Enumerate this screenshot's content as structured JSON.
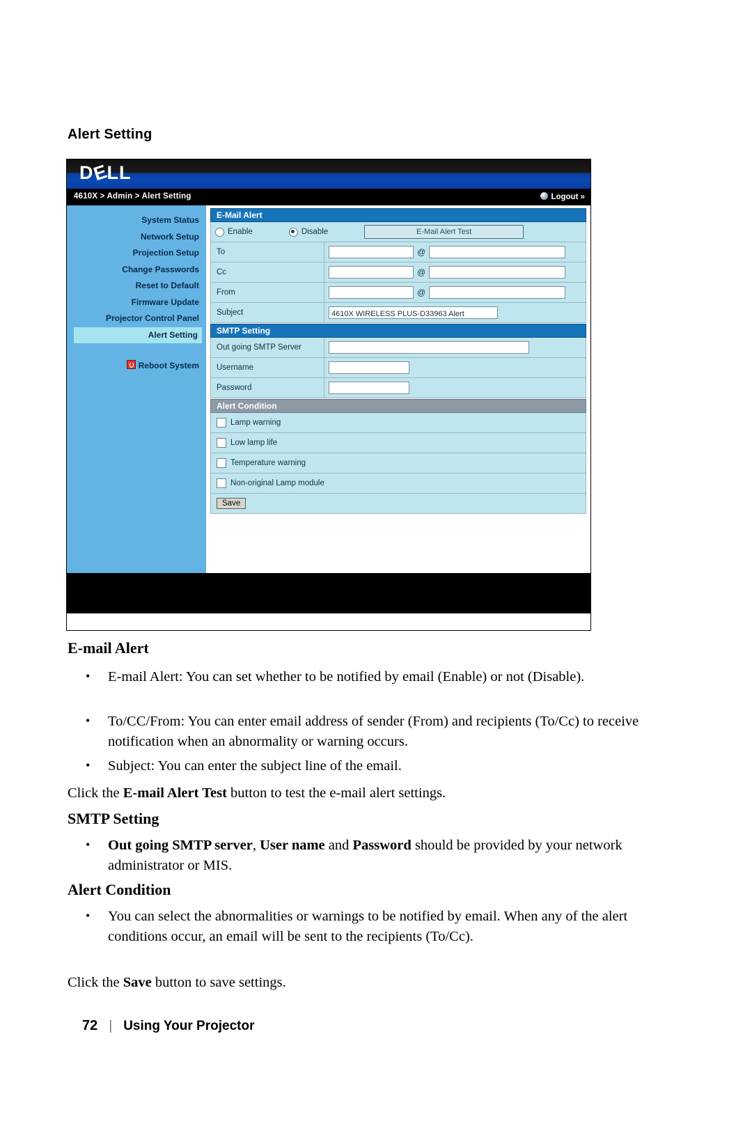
{
  "page": {
    "heading": "Alert Setting",
    "footer_page_number": "72",
    "footer_separator": "|",
    "footer_label": "Using Your Projector"
  },
  "screenshot": {
    "logo": "DÉLL",
    "breadcrumb": "4610X > Admin > Alert Setting",
    "logout": "Logout »",
    "sidebar": {
      "items": [
        "System Status",
        "Network Setup",
        "Projection Setup",
        "Change Passwords",
        "Reset to Default",
        "Firmware Update",
        "Projector Control Panel",
        "Alert Setting"
      ],
      "active": "Alert Setting",
      "reboot": "Reboot System"
    },
    "email_alert": {
      "title": "E-Mail Alert",
      "enable_label": "Enable",
      "disable_label": "Disable",
      "selected": "Disable",
      "test_button": "E-Mail Alert Test",
      "to_label": "To",
      "to_user": "",
      "to_domain": "",
      "cc_label": "Cc",
      "cc_user": "",
      "cc_domain": "",
      "from_label": "From",
      "from_user": "",
      "from_domain": "",
      "at_symbol": "@",
      "subject_label": "Subject",
      "subject_value": "4610X WIRELESS PLUS-D33963 Alert"
    },
    "smtp": {
      "title": "SMTP Setting",
      "server_label": "Out going SMTP Server",
      "server_value": "",
      "username_label": "Username",
      "username_value": "",
      "password_label": "Password",
      "password_value": ""
    },
    "alert_condition": {
      "title": "Alert Condition",
      "items": [
        {
          "label": "Lamp warning",
          "checked": false
        },
        {
          "label": "Low lamp life",
          "checked": false
        },
        {
          "label": "Temperature warning",
          "checked": false
        },
        {
          "label": "Non-original Lamp module",
          "checked": false
        }
      ],
      "save_button": "Save"
    }
  },
  "body": {
    "email_alert_heading": "E-mail Alert",
    "bullet1": "E-mail Alert: You can set whether to be notified by email (Enable) or not (Disable).",
    "bullet2": "To/CC/From: You can enter email address of sender (From) and recipients (To/Cc) to receive notification when an abnormality or warning occurs.",
    "bullet3": "Subject: You can enter the subject line of the email.",
    "para1_pre": "Click the ",
    "para1_bold": "E-mail Alert Test",
    "para1_post": " button to test the e-mail alert settings.",
    "smtp_heading": "SMTP Setting",
    "bullet4_b1": "Out going SMTP server",
    "bullet4_mid1": ", ",
    "bullet4_b2": "User name",
    "bullet4_mid2": " and ",
    "bullet4_b3": "Password",
    "bullet4_post": " should be provided by your network administrator or MIS.",
    "alert_condition_heading": "Alert Condition",
    "bullet5": "You can select the abnormalities or warnings to be notified by email. When any of the alert conditions occur, an email will be sent to the recipients (To/Cc).",
    "para2_pre": "Click the ",
    "para2_bold": "Save",
    "para2_post": " button to save settings."
  }
}
